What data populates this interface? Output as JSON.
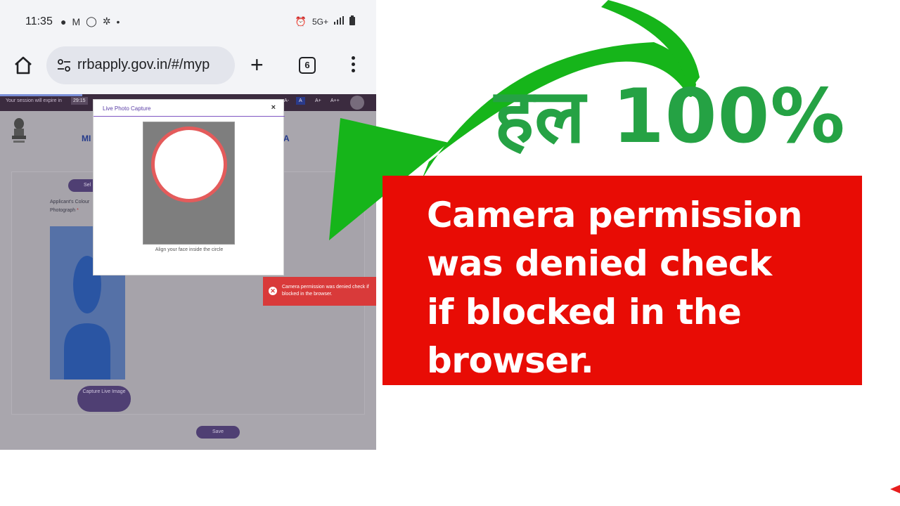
{
  "status_bar": {
    "time": "11:35",
    "network_label": "5G+"
  },
  "browser": {
    "url": "rrbapply.gov.in/#/myp",
    "tab_count": "6"
  },
  "webpage": {
    "session_text": "Your session will expire in",
    "session_timer": "29:15",
    "font_controls": [
      "A-",
      "A",
      "A+",
      "A++"
    ],
    "header_left": "MI",
    "header_right": "A",
    "select_button": "Sel",
    "applicant_label": "Applicant's Colour Photograph",
    "required_mark": "*",
    "capture_button": "Capture Live Image",
    "save_button": "Save"
  },
  "modal": {
    "title": "Live Photo Capture",
    "close_label": "×",
    "hint": "Align your face inside the circle"
  },
  "toast": {
    "message": "Camera permission was denied check if blocked in the browser."
  },
  "overlay": {
    "headline": "हल 100%",
    "banner_lines": [
      "Camera permission",
      "was denied check",
      "if blocked in the",
      "browser."
    ]
  },
  "colors": {
    "arrow_green": "#16b51a",
    "headline_green": "#25a244",
    "banner_red": "#e80c05",
    "toast_red": "#d93a3a",
    "camera_ring": "#e45b5b",
    "button_purple": "#4f3f73"
  }
}
